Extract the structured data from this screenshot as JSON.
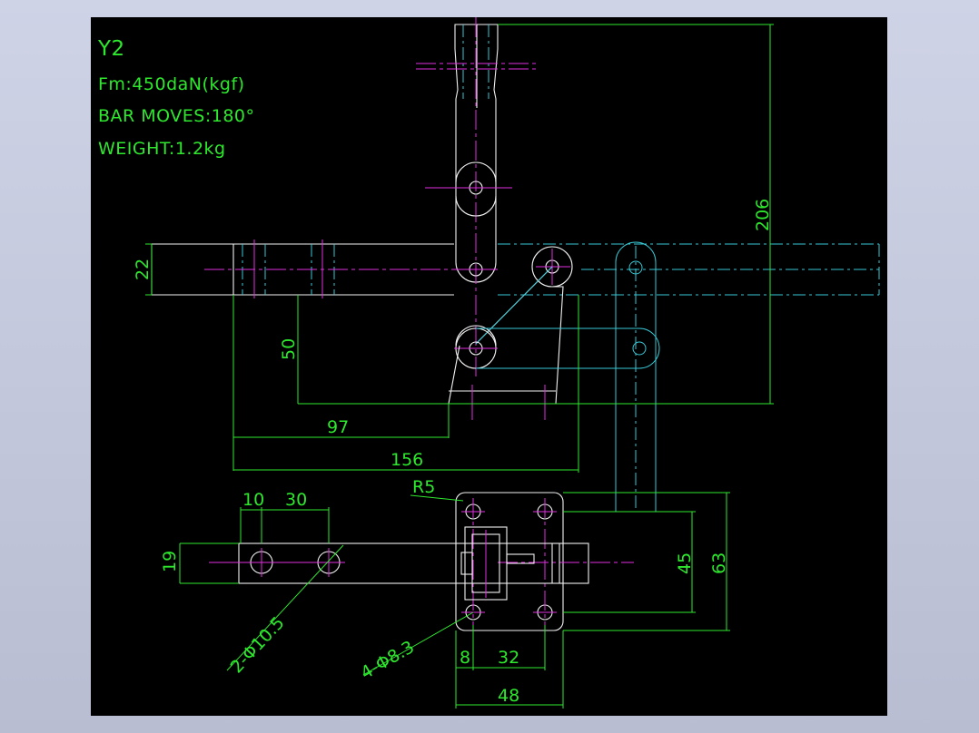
{
  "drawing": {
    "notes": {
      "model": "Y2",
      "force": "Fm:450daN(kgf)",
      "bar_moves": "BAR MOVES:180°",
      "weight": "WEIGHT:1.2kg"
    },
    "dimensions": {
      "height_total": "206",
      "bar_height": "22",
      "pivot_offset": "50",
      "base_to_pivot": "97",
      "base_to_end": "156",
      "radius": "R5",
      "pitch_10": "10",
      "pitch_30": "30",
      "bar_width": "19",
      "holes_bar": "2-Φ10.5",
      "holes_base": "4-Φ8.3",
      "base_8": "8",
      "base_32": "32",
      "base_48": "48",
      "base_45": "45",
      "base_63": "63"
    },
    "colors": {
      "background": "#000000",
      "dimension": "#2ee82e",
      "outline": "#f2f2f2",
      "centerline": "#e02ee0",
      "hidden": "#38c9d6"
    }
  }
}
